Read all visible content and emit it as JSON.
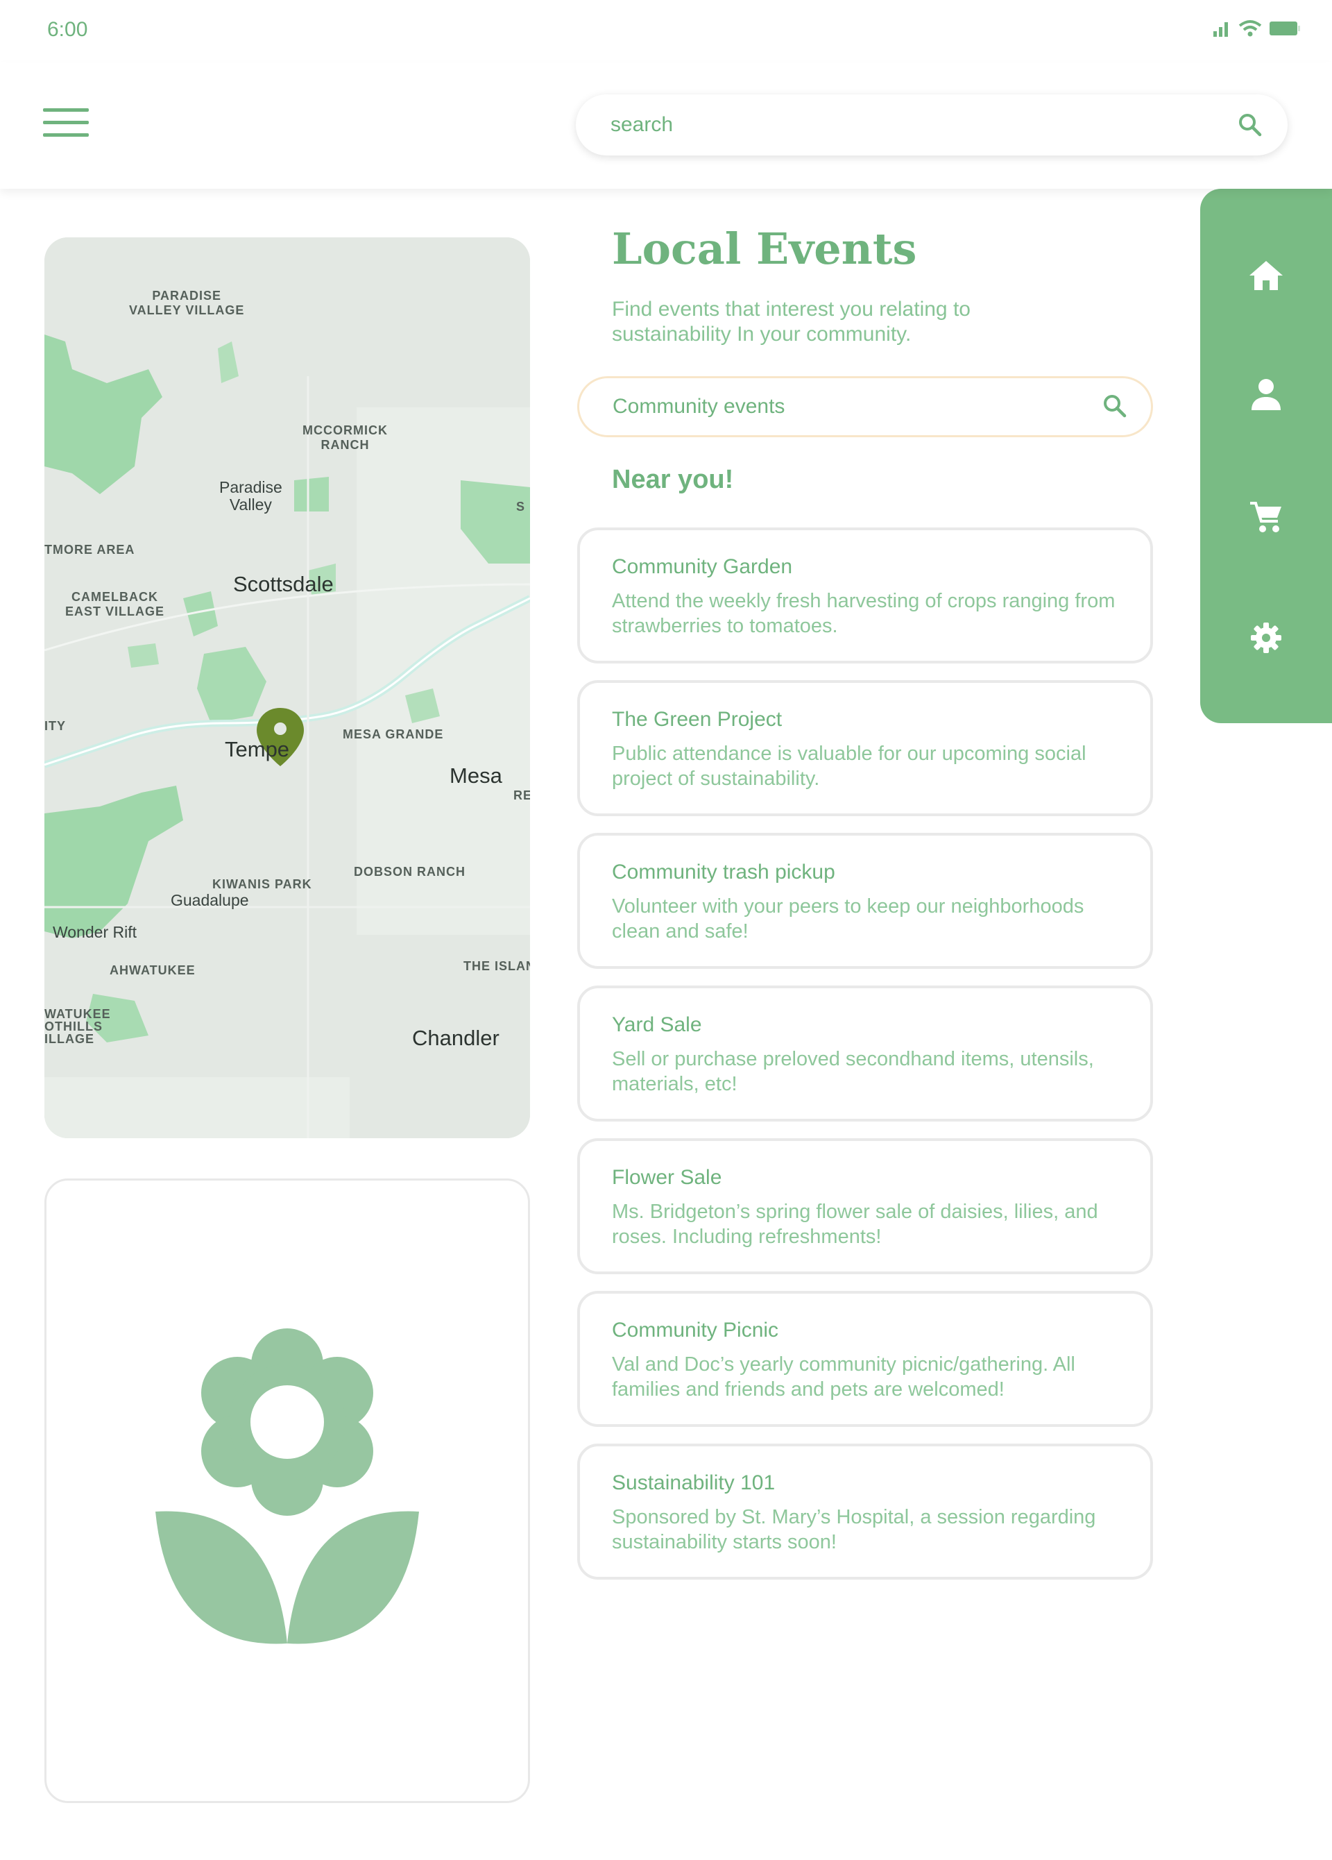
{
  "status_bar": {
    "time": "6:00"
  },
  "header": {
    "search_placeholder": "search"
  },
  "map": {
    "labels": {
      "paradise_valley_village": "PARADISE\nVALLEY VILLAGE",
      "mccormick_ranch": "MCCORMICK\nRANCH",
      "paradise_valley": "Paradise\nValley",
      "tmore_area": "TMORE AREA",
      "camelback_east_village": "CAMELBACK\nEAST VILLAGE",
      "scottsdale": "Scottsdale",
      "tempe": "Tempe",
      "mesa_grande": "MESA GRANDE",
      "mesa": "Mesa",
      "dobson_ranch": "DOBSON RANCH",
      "kiwanis_park": "KIWANIS PARK",
      "guadalupe": "Guadalupe",
      "wonder_rift": "Wonder Rift",
      "ahwatukee": "AHWATUKEE",
      "the_islands": "THE ISLAN",
      "ahwatukee_foothills": "WATUKEE\nOTHILLS\nILLAGE",
      "chandler": "Chandler",
      "ity": "ITY",
      "re": "RE",
      "s": "S"
    }
  },
  "main": {
    "title": "Local Events",
    "subtitle": "Find events that interest you relating to sustainability In your community.",
    "search_placeholder": "Community events",
    "near_heading": "Near you!",
    "events": [
      {
        "title": "Community Garden",
        "description": "Attend the weekly fresh harvesting of crops ranging from strawberries to tomatoes."
      },
      {
        "title": "The Green Project",
        "description": "Public attendance is valuable for our upcoming social project of sustainability."
      },
      {
        "title": "Community trash pickup",
        "description": "Volunteer with your peers to keep our neighborhoods clean and safe!"
      },
      {
        "title": "Yard Sale",
        "description": "Sell or purchase preloved secondhand items, utensils, materials, etc!"
      },
      {
        "title": "Flower Sale",
        "description": "Ms. Bridgeton’s spring flower sale of daisies, lilies, and roses. Including refreshments!"
      },
      {
        "title": "Community Picnic",
        "description": "Val and Doc’s yearly community picnic/gathering. All families and friends and pets are welcomed!"
      },
      {
        "title": "Sustainability 101",
        "description": "Sponsored by St. Mary’s Hospital, a session regarding sustainability starts soon!"
      }
    ]
  },
  "rail": {
    "items": [
      {
        "icon": "home-icon"
      },
      {
        "icon": "person-icon"
      },
      {
        "icon": "cart-icon"
      },
      {
        "icon": "settings-icon"
      }
    ]
  },
  "colors": {
    "primary": "#6fb37e",
    "rail": "#79bb84",
    "flower": "#97c6a1",
    "map_bg": "#e3e8e3",
    "map_park": "#9fd7aa",
    "pin": "#6b8a2c"
  }
}
